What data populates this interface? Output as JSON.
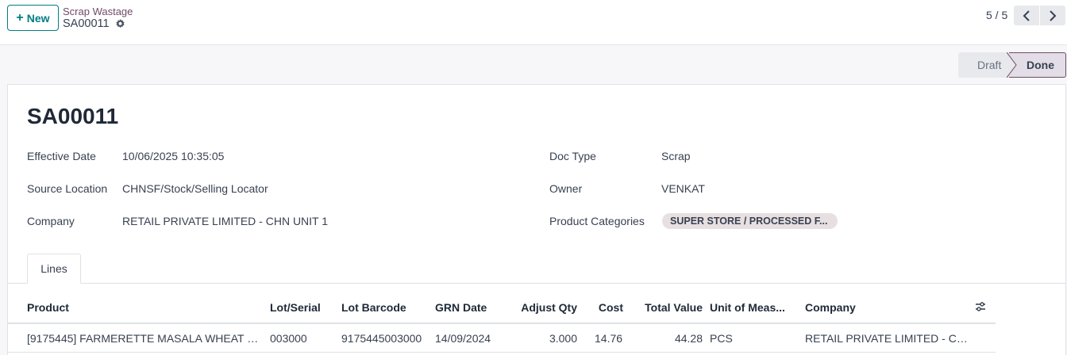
{
  "control_panel": {
    "new_button_label": "New",
    "breadcrumb_parent": "Scrap Wastage",
    "breadcrumb_current": "SA00011",
    "pager_value": "5 / 5"
  },
  "statusbar": {
    "stages": [
      "Draft",
      "Done"
    ],
    "current": "Done"
  },
  "form": {
    "title": "SA00011",
    "effective_date_label": "Effective Date",
    "effective_date": "10/06/2025 10:35:05",
    "source_location_label": "Source Location",
    "source_location": "CHNSF/Stock/Selling Locator",
    "company_label": "Company",
    "company": "RETAIL PRIVATE LIMITED - CHN UNIT 1",
    "doc_type_label": "Doc Type",
    "doc_type": "Scrap",
    "owner_label": "Owner",
    "owner": "VENKAT",
    "product_categories_label": "Product Categories",
    "product_category_tag": "SUPER STORE / PROCESSED F..."
  },
  "notebook": {
    "tabs": [
      "Lines"
    ]
  },
  "lines_table": {
    "columns": [
      "Product",
      "Lot/Serial",
      "Lot Barcode",
      "GRN Date",
      "Adjust Qty",
      "Cost",
      "Total Value",
      "Unit of Meas...",
      "Company"
    ],
    "rows": [
      {
        "product": "[9175445] FARMERETTE MASALA WHEAT P...",
        "lot_serial": "003000",
        "lot_barcode": "9175445003000",
        "grn_date": "14/09/2024",
        "adjust_qty": "3.000",
        "cost": "14.76",
        "total_value": "44.28",
        "uom": "PCS",
        "company": "RETAIL PRIVATE LIMITED - CH..."
      }
    ]
  },
  "colors": {
    "primary": "#714b67",
    "new_button": "#017e84"
  },
  "icons": [
    "plus-icon",
    "gear-icon",
    "chevron-left-icon",
    "chevron-right-icon",
    "optional-columns-icon"
  ]
}
